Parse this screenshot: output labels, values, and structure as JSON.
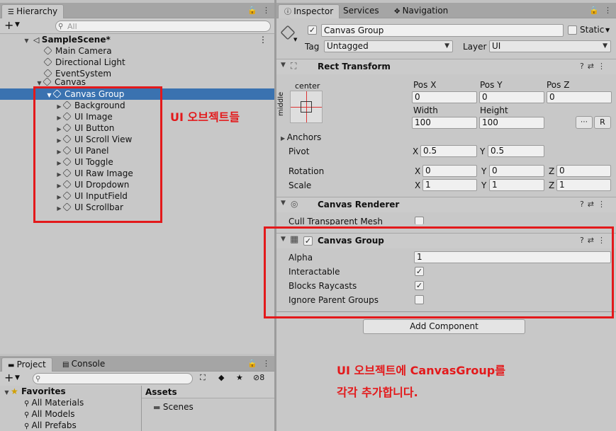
{
  "hierarchy": {
    "tab_label": "Hierarchy",
    "search_placeholder": "All",
    "scene_name": "SampleScene*",
    "items": [
      {
        "label": "Main Camera"
      },
      {
        "label": "Directional Light"
      },
      {
        "label": "EventSystem"
      },
      {
        "label": "Canvas"
      }
    ],
    "selected": "Canvas Group",
    "children": [
      {
        "label": "Background"
      },
      {
        "label": "UI Image"
      },
      {
        "label": "UI Button"
      },
      {
        "label": "UI Scroll View"
      },
      {
        "label": "UI Panel"
      },
      {
        "label": "UI Toggle"
      },
      {
        "label": "UI Raw Image"
      },
      {
        "label": "UI Dropdown"
      },
      {
        "label": "UI InputField"
      },
      {
        "label": "UI Scrollbar"
      }
    ]
  },
  "project": {
    "tabs": [
      "Project",
      "Console"
    ],
    "badge_count": "8",
    "favorites_label": "Favorites",
    "favorites": [
      "All Materials",
      "All Models",
      "All Prefabs"
    ],
    "assets_label": "Assets",
    "assets": [
      "Scenes"
    ]
  },
  "inspector": {
    "tabs": [
      "Inspector",
      "Services",
      "Navigation"
    ],
    "object_name": "Canvas Group",
    "static_label": "Static",
    "tag_label": "Tag",
    "tag_value": "Untagged",
    "layer_label": "Layer",
    "layer_value": "UI",
    "rect_transform": {
      "title": "Rect Transform",
      "anchor_top": "center",
      "anchor_side": "middle",
      "pos_x_label": "Pos X",
      "pos_x": "0",
      "pos_y_label": "Pos Y",
      "pos_y": "0",
      "pos_z_label": "Pos Z",
      "pos_z": "0",
      "width_label": "Width",
      "width": "100",
      "height_label": "Height",
      "height": "100",
      "r_button": "R",
      "anchors_label": "Anchors",
      "pivot_label": "Pivot",
      "pivot_x": "0.5",
      "pivot_y": "0.5",
      "rotation_label": "Rotation",
      "rot_x": "0",
      "rot_y": "0",
      "rot_z": "0",
      "scale_label": "Scale",
      "scale_x": "1",
      "scale_y": "1",
      "scale_z": "1",
      "x": "X",
      "y": "Y",
      "z": "Z"
    },
    "canvas_renderer": {
      "title": "Canvas Renderer",
      "cull_label": "Cull Transparent Mesh"
    },
    "canvas_group": {
      "title": "Canvas Group",
      "alpha_label": "Alpha",
      "alpha": "1",
      "interactable_label": "Interactable",
      "blocks_raycasts_label": "Blocks Raycasts",
      "ignore_parent_label": "Ignore Parent Groups"
    },
    "add_component": "Add Component"
  },
  "annotations": {
    "objects": "UI 오브젝트들",
    "line1": "UI 오브젝트에 CanvasGroup를",
    "line2": "각각 추가합니다."
  },
  "colors": {
    "selection": "#3a72b0",
    "annotation": "#e3191b"
  }
}
